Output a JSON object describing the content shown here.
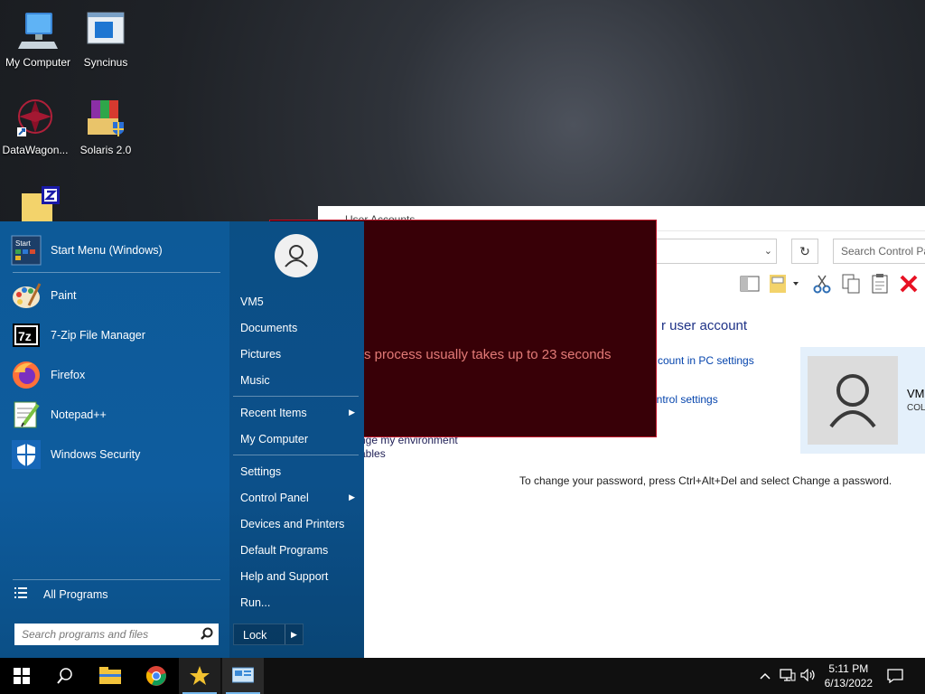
{
  "desktop": {
    "icons": [
      {
        "label": "My Computer"
      },
      {
        "label": "Syncinus"
      },
      {
        "label": "DataWagon..."
      },
      {
        "label": "Solaris 2.0"
      }
    ]
  },
  "control_panel": {
    "title": "User Accounts",
    "search_placeholder": "Search Control Pa",
    "heading": "r user account",
    "links": [
      "count in PC settings",
      "ontrol settings"
    ],
    "env_line1": "nge my environment",
    "env_line2": "ables",
    "password_note": "To change your password, press Ctrl+Alt+Del and select Change a password.",
    "card_name": "VM",
    "card_sub": "COL"
  },
  "overlay": {
    "message": "s process usually takes up to 23 seconds"
  },
  "start_menu": {
    "programs": [
      {
        "label": "Start Menu (Windows)"
      },
      {
        "label": "Paint"
      },
      {
        "label": "7-Zip File Manager"
      },
      {
        "label": "Firefox"
      },
      {
        "label": "Notepad++"
      },
      {
        "label": "Windows Security"
      }
    ],
    "all_programs": "All Programs",
    "search_placeholder": "Search programs and files",
    "right_items": {
      "user": "VM5",
      "documents": "Documents",
      "pictures": "Pictures",
      "music": "Music",
      "recent": "Recent Items",
      "computer": "My Computer",
      "settings": "Settings",
      "control_panel": "Control Panel",
      "devices": "Devices and Printers",
      "defaults": "Default Programs",
      "help": "Help and Support",
      "run": "Run..."
    },
    "lock": "Lock"
  },
  "taskbar": {
    "time": "5:11 PM",
    "date": "6/13/2022"
  },
  "colors": {
    "start_bg": "#0e5c9e",
    "overlay_bg": "#380007",
    "overlay_text": "#e27b77",
    "link": "#0645ad"
  }
}
